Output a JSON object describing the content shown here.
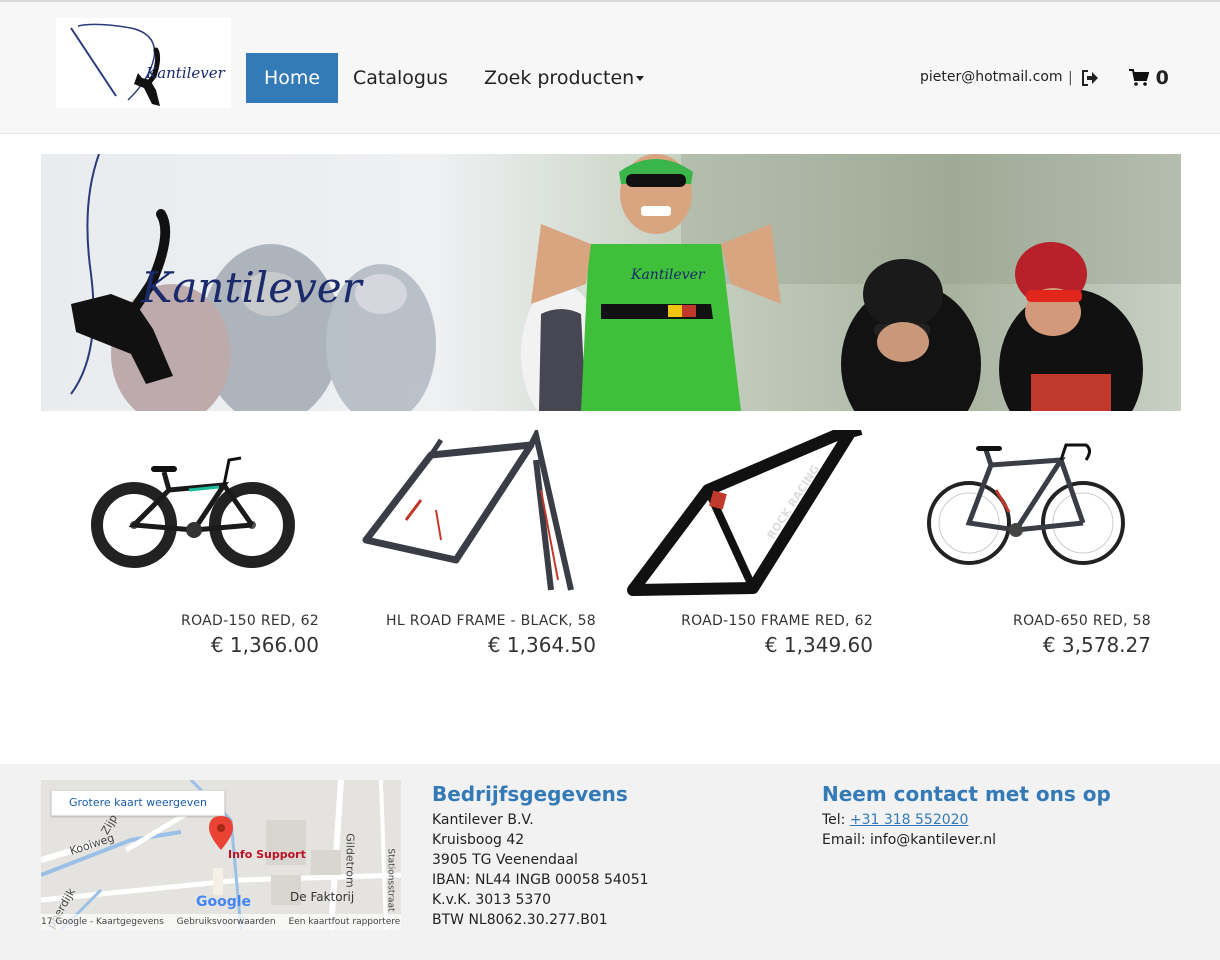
{
  "header": {
    "logo_text": "Kantilever",
    "nav": {
      "home": "Home",
      "catalogus": "Catalogus",
      "zoek": "Zoek producten"
    },
    "user_email": "pieter@hotmail.com",
    "separator": "|",
    "cart_count": "0"
  },
  "banner": {
    "logo_text": "Kantilever",
    "jersey_text": "Kantilever"
  },
  "products": [
    {
      "name": "ROAD-150 RED, 62",
      "price": "€ 1,366.00",
      "image": "fat-bike"
    },
    {
      "name": "HL ROAD FRAME - BLACK, 58",
      "price": "€ 1,364.50",
      "image": "road-frame-black"
    },
    {
      "name": "ROAD-150 FRAME RED, 62",
      "price": "€ 1,349.60",
      "image": "rock-racing-frame"
    },
    {
      "name": "ROAD-650 RED, 58",
      "price": "€ 3,578.27",
      "image": "road-bike"
    }
  ],
  "footer": {
    "map": {
      "larger_map_button": "Grotere kaart weergeven",
      "place_label": "Info Support",
      "poi_label": "De Faktorij",
      "street_kooiweg": "Kooiweg",
      "street_gildetrom": "Gildetrom",
      "street_stationsstraat": "Stationsstraat",
      "street_zijp": "Zijp",
      "street_hoperdijk": "pperdijk",
      "google": "Google",
      "attribution": [
        "17 Google - Kaartgegevens",
        "Gebruiksvoorwaarden",
        "Een kaartfout rapporteren"
      ]
    },
    "bedrijf": {
      "title": "Bedrijfsgegevens",
      "lines": [
        "Kantilever B.V.",
        "Kruisboog 42",
        "3905 TG Veenendaal",
        "IBAN: NL44 INGB 00058 54051",
        "K.v.K. 3013 5370",
        "BTW NL8062.30.277.B01"
      ]
    },
    "contact": {
      "title": "Neem contact met ons op",
      "tel_label": "Tel: ",
      "tel": "+31 318 552020",
      "email_line": "Email: info@kantilever.nl"
    }
  },
  "colors": {
    "accent": "#337ab7",
    "header_bg": "#f7f7f7",
    "footer_bg": "#f2f2f2"
  }
}
